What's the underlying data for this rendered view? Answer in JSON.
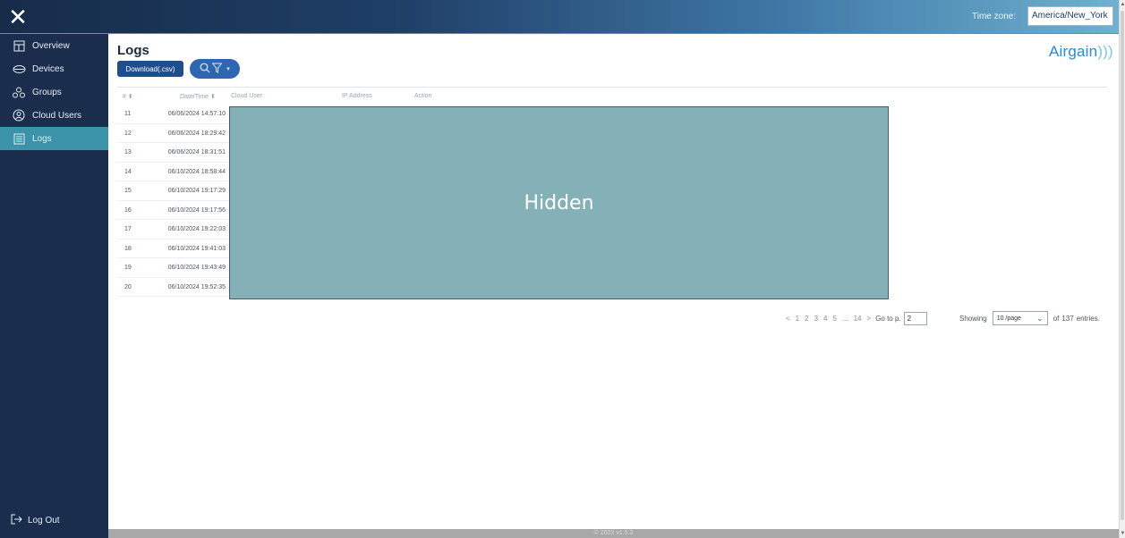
{
  "topbar": {
    "close_glyph": "✕",
    "timezone_label": "Time zone:",
    "timezone_value": "America/New_York"
  },
  "sidebar": {
    "items": [
      {
        "label": "Overview",
        "icon": "overview-icon"
      },
      {
        "label": "Devices",
        "icon": "devices-icon"
      },
      {
        "label": "Groups",
        "icon": "groups-icon"
      },
      {
        "label": "Cloud Users",
        "icon": "cloud-users-icon"
      },
      {
        "label": "Logs",
        "icon": "logs-icon",
        "active": true
      }
    ],
    "logout_label": "Log Out"
  },
  "main": {
    "title": "Logs",
    "brand": "Airgain",
    "download_label": "Download(.csv)",
    "table": {
      "headers": [
        "# ⬍",
        "Date/Time ⬍",
        "Cloud User",
        "IP Address",
        "Action"
      ],
      "rows": [
        {
          "idx": "11",
          "datetime": "06/06/2024 14:57:10"
        },
        {
          "idx": "12",
          "datetime": "06/06/2024 18:29:42"
        },
        {
          "idx": "13",
          "datetime": "06/06/2024 18:31:51"
        },
        {
          "idx": "14",
          "datetime": "06/10/2024 18:58:44"
        },
        {
          "idx": "15",
          "datetime": "06/10/2024 19:17:29"
        },
        {
          "idx": "16",
          "datetime": "06/10/2024 19:17:56"
        },
        {
          "idx": "17",
          "datetime": "06/10/2024 19:22:03"
        },
        {
          "idx": "18",
          "datetime": "06/10/2024 19:41:03"
        },
        {
          "idx": "19",
          "datetime": "06/10/2024 19:43:49"
        },
        {
          "idx": "20",
          "datetime": "06/10/2024 19:52:35"
        }
      ],
      "hidden_label": "Hidden"
    },
    "pagination": {
      "prev": "<",
      "pages": [
        "1",
        "2",
        "3",
        "4",
        "5",
        "...",
        "14"
      ],
      "next": ">",
      "goto_label": "Go to p.",
      "goto_value": "2",
      "showing_label": "Showing",
      "page_size": "10 /page",
      "of_label": "of",
      "total": "137",
      "entries_label": "entries."
    }
  },
  "footer": {
    "text": "© 2023 v1.5.3"
  }
}
